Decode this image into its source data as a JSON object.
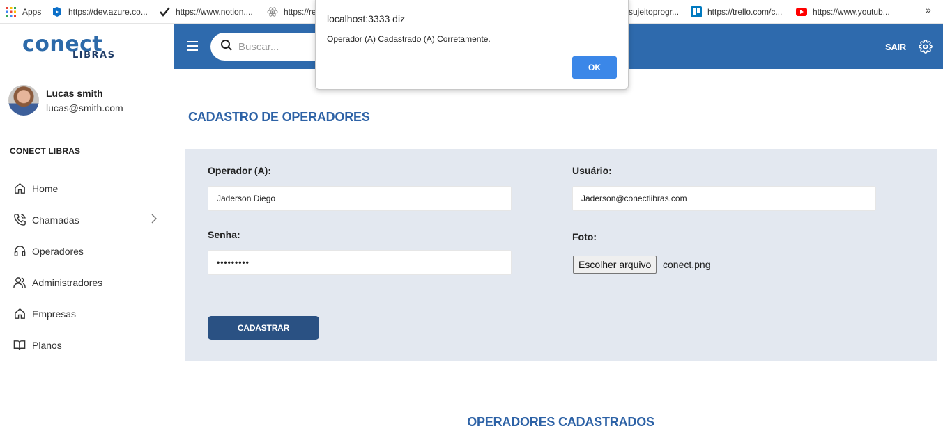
{
  "bookmarks": [
    {
      "label": "Apps",
      "icon": "apps-grid-icon"
    },
    {
      "label": "https://dev.azure.co...",
      "icon": "azure-icon"
    },
    {
      "label": "https://www.notion....",
      "icon": "notion-check-icon"
    },
    {
      "label": "https://re",
      "icon": "react-icon"
    },
    {
      "label": "sujeitoprogr...",
      "icon": ""
    },
    {
      "label": "https://trello.com/c...",
      "icon": "trello-icon"
    },
    {
      "label": "https://www.youtub...",
      "icon": "youtube-icon"
    }
  ],
  "bookmarks_more": "»",
  "brand": {
    "logo_main": "conect",
    "logo_sub": "LIBRAS"
  },
  "user": {
    "name": "Lucas smith",
    "email": "lucas@smith.com"
  },
  "sidebar": {
    "section_title": "CONECT LIBRAS",
    "items": [
      {
        "label": "Home",
        "icon": "home-icon"
      },
      {
        "label": "Chamadas",
        "icon": "phone-icon",
        "has_submenu": true
      },
      {
        "label": "Operadores",
        "icon": "headset-icon"
      },
      {
        "label": "Administradores",
        "icon": "users-icon"
      },
      {
        "label": "Empresas",
        "icon": "building-icon"
      },
      {
        "label": "Planos",
        "icon": "book-icon"
      }
    ]
  },
  "header": {
    "search_placeholder": "Buscar...",
    "logout_label": "SAIR",
    "colors": {
      "bar": "#2e6aad"
    }
  },
  "page": {
    "title": "CADASTRO DE OPERADORES",
    "form": {
      "operator_label": "Operador (A):",
      "operator_value": "Jaderson Diego",
      "user_label": "Usuário:",
      "user_value": "Jaderson@conectlibras.com",
      "password_label": "Senha:",
      "password_value": "•••••••••",
      "photo_label": "Foto:",
      "file_button": "Escolher arquivo",
      "file_name": "conect.png",
      "submit_label": "CADASTRAR"
    },
    "list_title": "OPERADORES CADASTRADOS"
  },
  "alert": {
    "title": "localhost:3333 diz",
    "message": "Operador (A) Cadastrado (A) Corretamente.",
    "ok_label": "OK"
  }
}
